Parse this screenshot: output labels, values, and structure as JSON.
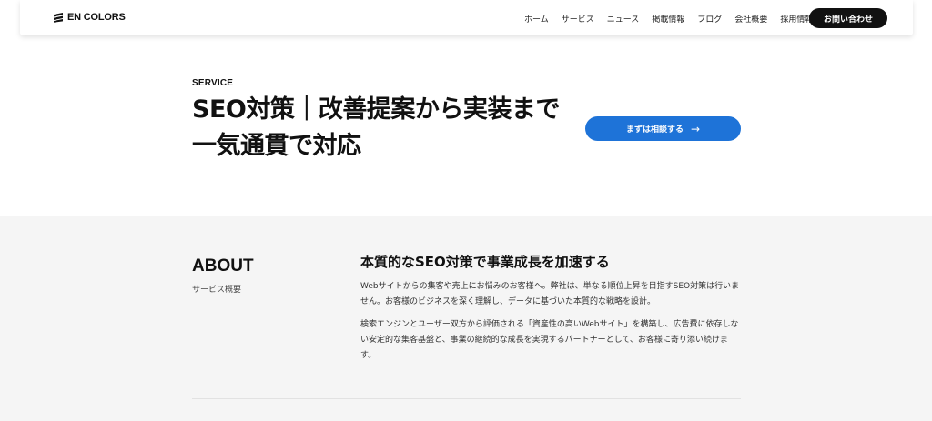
{
  "header": {
    "logo_text": "EN COLORS",
    "nav": [
      "ホーム",
      "サービス",
      "ニュース",
      "掲載情報",
      "ブログ",
      "会社概要",
      "採用情報"
    ],
    "contact_label": "お問い合わせ"
  },
  "hero": {
    "eyebrow": "SERVICE",
    "title": "SEO対策｜改善提案から実装まで一気通貫で対応",
    "cta_label": "まずは相談する",
    "cta_arrow": "→"
  },
  "about": {
    "heading": "ABOUT",
    "subheading": "サービス概要",
    "title": "本質的なSEO対策で事業成長を加速する",
    "paragraph1": "Webサイトからの集客や売上にお悩みのお客様へ。弊社は、単なる順位上昇を目指すSEO対策は行いません。お客様のビジネスを深く理解し、データに基づいた本質的な戦略を設計。",
    "paragraph2": "検索エンジンとユーザー双方から評価される「資産性の高いWebサイト」を構築し、広告費に依存しない安定的な集客基盤と、事業の継続的な成長を実現するパートナーとして、お客様に寄り添い続けます。"
  },
  "colors": {
    "accent": "#1e73d8",
    "dark_button": "#111111",
    "section_bg": "#f5f5f5"
  }
}
